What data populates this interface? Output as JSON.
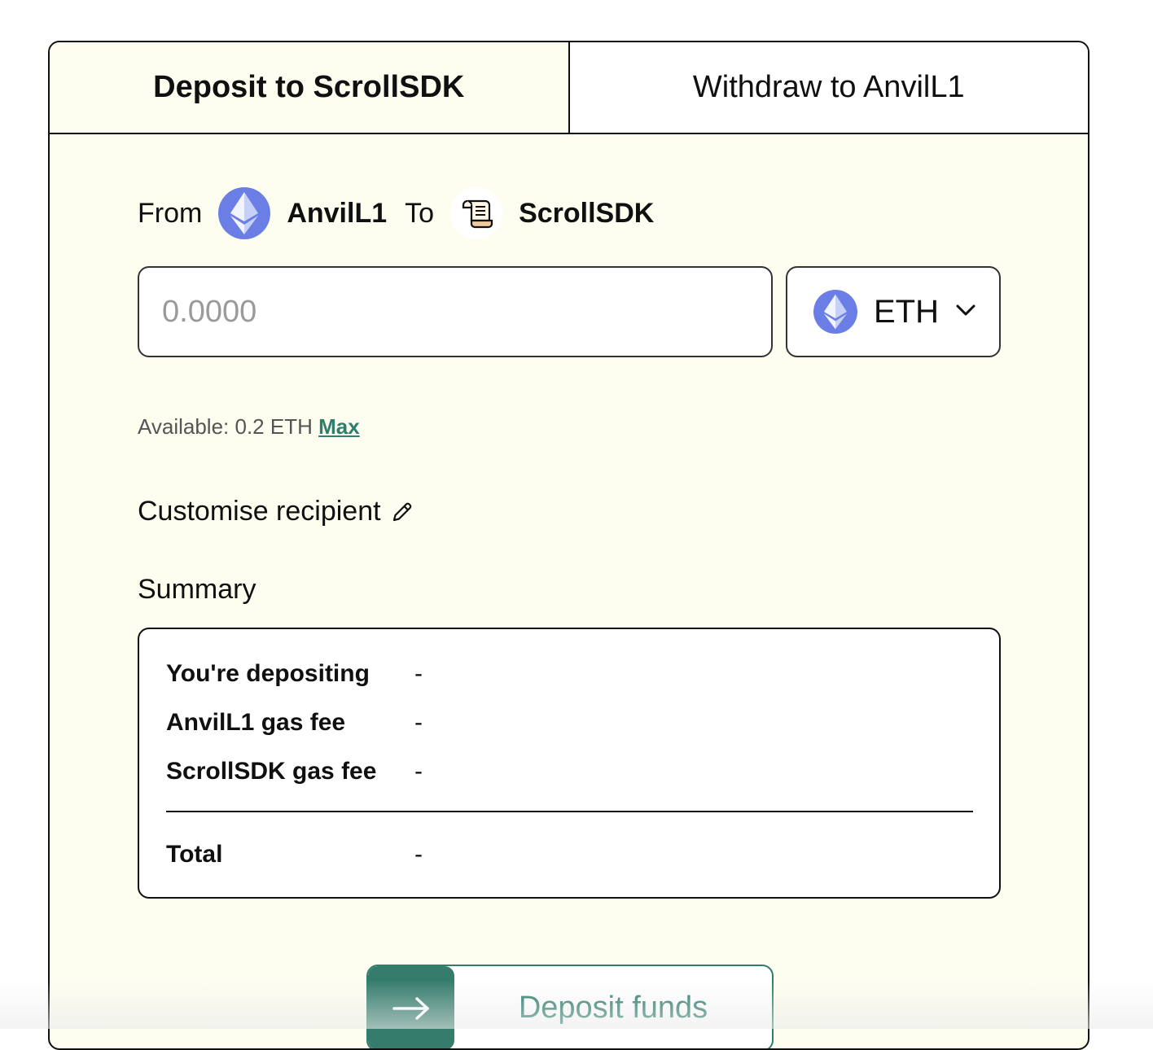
{
  "tabs": {
    "deposit": "Deposit to ScrollSDK",
    "withdraw": "Withdraw to AnvilL1"
  },
  "route": {
    "from_label": "From",
    "from_network": "AnvilL1",
    "to_label": "To",
    "to_network": "ScrollSDK"
  },
  "amount": {
    "placeholder": "0.0000",
    "value": ""
  },
  "token": {
    "symbol": "ETH"
  },
  "available": {
    "text": "Available: 0.2 ETH",
    "max_label": "Max"
  },
  "customise_label": "Customise recipient",
  "summary": {
    "title": "Summary",
    "rows": [
      {
        "label": "You're depositing",
        "value": "-"
      },
      {
        "label": "AnvilL1 gas fee",
        "value": "-"
      },
      {
        "label": "ScrollSDK gas fee",
        "value": "-"
      }
    ],
    "total": {
      "label": "Total",
      "value": "-"
    }
  },
  "deposit_button_label": "Deposit funds",
  "colors": {
    "card_bg": "#fdfdf0",
    "accent": "#2f7d6d",
    "eth": "#6b7ee6"
  },
  "icons": {
    "eth": "ethereum-icon",
    "scroll": "scroll-icon",
    "chevron": "chevron-down-icon",
    "pencil": "pencil-icon",
    "arrow": "arrow-right-icon"
  }
}
